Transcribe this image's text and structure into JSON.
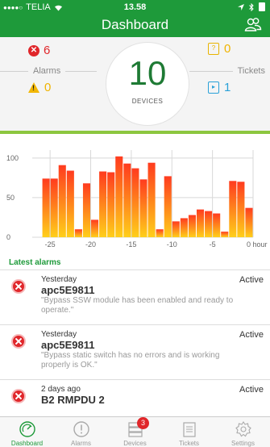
{
  "status_bar": {
    "carrier": "TELIA",
    "time": "13.58"
  },
  "header": {
    "title": "Dashboard",
    "users_icon": "users-icon"
  },
  "summary": {
    "alarms_label": "Alarms",
    "alarms_critical": "6",
    "alarms_warning": "0",
    "devices_count": "10",
    "devices_label": "DEVICES",
    "tickets_label": "Tickets",
    "tickets_yellow": "0",
    "tickets_blue": "1",
    "colors": {
      "critical": "#e0262a",
      "warning": "#f0b400",
      "ticket_blue": "#2aa1d8",
      "brand_green": "#1e9a3a"
    }
  },
  "chart_data": {
    "type": "bar",
    "x_tick_labels": [
      "-25",
      "-20",
      "-15",
      "-10",
      "-5",
      "0 hour"
    ],
    "y_tick_labels": [
      "0",
      "50",
      "100"
    ],
    "x": [
      -26,
      -25,
      -24,
      -23,
      -22,
      -21,
      -20,
      -19,
      -18,
      -17,
      -16,
      -15,
      -14,
      -13,
      -12,
      -11,
      -10,
      -9,
      -8,
      -7,
      -6,
      -5,
      -4,
      -3,
      -2,
      -1
    ],
    "values": [
      74,
      74,
      91,
      84,
      10,
      68,
      22,
      83,
      82,
      102,
      93,
      87,
      73,
      94,
      10,
      77,
      20,
      24,
      28,
      35,
      33,
      30,
      7,
      71,
      70,
      37
    ],
    "ylim": [
      0,
      110
    ],
    "xlim": [
      -27,
      0
    ],
    "grid": true,
    "colors": {
      "top": "#ff3b1f",
      "bottom": "#ffcf1a"
    }
  },
  "latest_alarms": {
    "title": "Latest alarms",
    "items": [
      {
        "when": "Yesterday",
        "state": "Active",
        "name": "apc5E9811",
        "desc": "\"Bypass SSW module has been enabled and ready to operate.\""
      },
      {
        "when": "Yesterday",
        "state": "Active",
        "name": "apc5E9811",
        "desc": "\"Bypass static switch has no errors and is working properly is OK.\""
      },
      {
        "when": "2 days ago",
        "state": "Active",
        "name": "B2 RMPDU 2",
        "desc": ""
      }
    ]
  },
  "tabs": [
    {
      "label": "Dashboard",
      "icon": "dashboard-icon"
    },
    {
      "label": "Alarms",
      "icon": "alarm-icon"
    },
    {
      "label": "Devices",
      "icon": "devices-icon",
      "badge": "3"
    },
    {
      "label": "Tickets",
      "icon": "tickets-icon"
    },
    {
      "label": "Settings",
      "icon": "settings-icon"
    }
  ]
}
